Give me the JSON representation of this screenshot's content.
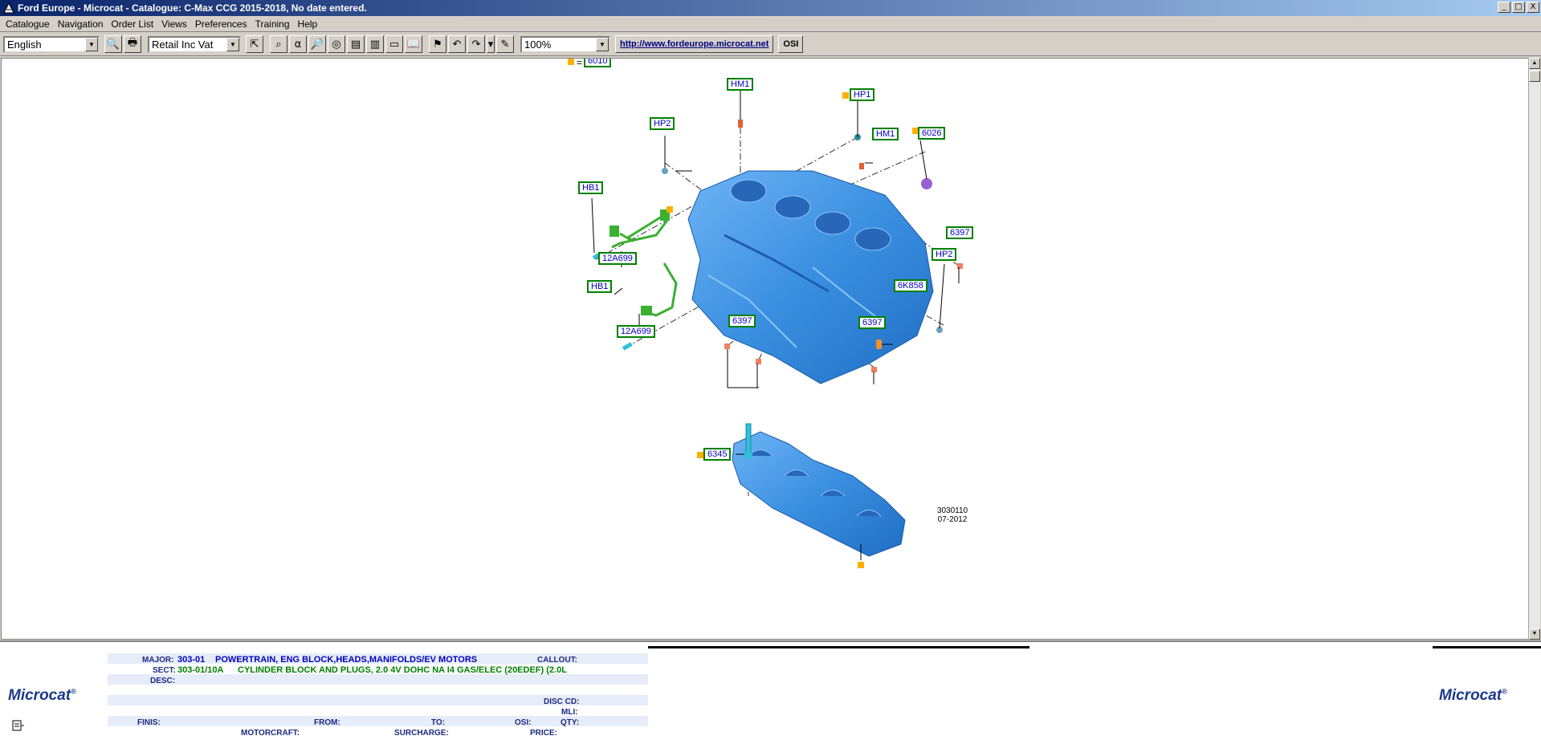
{
  "window": {
    "title": "Ford Europe - Microcat - Catalogue: C-Max CCG 2015-2018, No date entered.",
    "controls": [
      "_",
      "□",
      "X"
    ]
  },
  "menu": [
    "Catalogue",
    "Navigation",
    "Order List",
    "Views",
    "Preferences",
    "Training",
    "Help"
  ],
  "toolbar": {
    "language": "English",
    "price_mode": "Retail Inc Vat",
    "zoom": "100%",
    "url": "http://www.fordeurope.microcat.net",
    "osi": "OSI"
  },
  "diagram": {
    "callouts": [
      "6010",
      "HM1",
      "HP1",
      "HP2",
      "HM1",
      "6026",
      "HB1",
      "6397",
      "12A699",
      "HP2",
      "HB1",
      "6K858",
      "6397",
      "6397",
      "12A699",
      "6345"
    ],
    "illustration_id": "3030110",
    "illustration_date": "07-2012"
  },
  "footer": {
    "brand": "Microcat",
    "major_label": "MAJOR:",
    "major_code": "303-01",
    "major_desc": "POWERTRAIN, ENG BLOCK,HEADS,MANIFOLDS/EV MOTORS",
    "callout_label": "CALLOUT:",
    "sect_label": "SECT:",
    "sect_code": "303-01/10A",
    "sect_desc": "CYLINDER BLOCK AND PLUGS, 2.0 4V DOHC NA I4 GAS/ELEC (20EDEF) (2.0L",
    "desc_label": "DESC:",
    "disc_cd_label": "DISC CD:",
    "mli_label": "MLI:",
    "finis_label": "FINIS:",
    "from_label": "FROM:",
    "to_label": "TO:",
    "osi_label": "OSI:",
    "qty_label": "QTY:",
    "motorcraft_label": "MOTORCRAFT:",
    "surcharge_label": "SURCHARGE:",
    "price_label": "PRICE:"
  },
  "colors": {
    "block": "#3a8fe0",
    "callout_border": "#008000",
    "callout_text": "#0000c0",
    "marker": "#ffb000"
  }
}
